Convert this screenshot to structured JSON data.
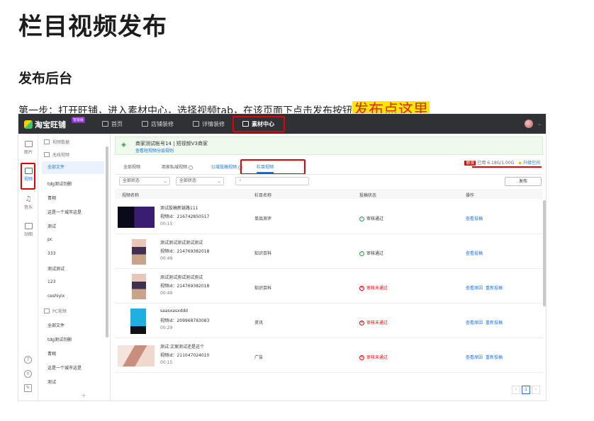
{
  "doc": {
    "title": "栏目视频发布",
    "subtitle": "发布后台",
    "step_text": "第一步：打开旺铺，进入素材中心，选择视频tab，在该页面下点击发布按钮",
    "step_highlight": "发布点这里"
  },
  "app": {
    "brand": "淘宝旺铺",
    "brand_badge": "智能版",
    "nav": {
      "home": "首页",
      "shop": "店铺装修",
      "detail": "详情装修",
      "material": "素材中心"
    },
    "iconbar": {
      "image": "图片",
      "video": "视频",
      "music": "音乐",
      "anim": "动图"
    },
    "categories": {
      "data_head": "视频数据",
      "wireless_head": "无线视频",
      "wireless_items": [
        "全部文件",
        "tdg测试勿删",
        "青翔",
        "这是一个城市这是",
        "测试",
        "pc",
        "333",
        "测试测试",
        "123",
        "ceshiyix"
      ],
      "pc_head": "PC视频",
      "pc_items": [
        "全部文件",
        "tdg测试勿删",
        "青翔",
        "这是一个城市这是",
        "测试"
      ],
      "add": "+"
    },
    "notice": {
      "line1": "商家测试帐号14 | 短视频V3商家",
      "line2": "查看短视频分层规则"
    },
    "tabs": {
      "all": "全部视频",
      "private": "商家私域视频",
      "public": "公域投稿视频",
      "column": "栏目视频"
    },
    "storage": {
      "tag": "额度",
      "used": "已用 6.18G/1.00G",
      "upgrade": "升级空间"
    },
    "filters": {
      "status1": "全部状态",
      "status2": "全部状态",
      "publish": "发布"
    },
    "table": {
      "headers": {
        "name": "视频名称",
        "column": "栏目名称",
        "status": "投稿状态",
        "ops": "操作"
      },
      "rows": [
        {
          "title": "测试投稿新链路111",
          "vid": "视频id：216742850517",
          "dur": "00:15",
          "column": "单品测评",
          "status": "审核通过",
          "ops": [
            "查看投稿"
          ]
        },
        {
          "title": "测试测试测试测试测试",
          "vid": "视频id：214769382018",
          "dur": "00:49",
          "column": "知识百科",
          "status": "审核通过",
          "ops": [
            "查看投稿"
          ]
        },
        {
          "title": "测试测试测试测试测试",
          "vid": "视频id：214769382018",
          "dur": "00:49",
          "column": "知识百科",
          "status": "审核未通过",
          "ops": [
            "查看原因",
            "重新投稿"
          ]
        },
        {
          "title": "saasxasxddd",
          "vid": "视频id：209968783083",
          "dur": "00:29",
          "column": "资讯",
          "status": "审核未通过",
          "ops": [
            "查看原因",
            "重新投稿"
          ]
        },
        {
          "title": "测试:文案测试还是这个",
          "vid": "视频id：211047024010",
          "dur": "00:15",
          "column": "广告",
          "status": "审核未通过",
          "ops": [
            "查看原因",
            "重新投稿"
          ]
        }
      ]
    },
    "pager": {
      "prev": "‹",
      "current": "1",
      "next": "›"
    }
  },
  "colors": {
    "highlight_bg": "#ffe500",
    "highlight_text": "#e1251b",
    "annotation_red": "#e40000",
    "link_blue": "#1a73e8",
    "topbar": "#2f3134"
  }
}
